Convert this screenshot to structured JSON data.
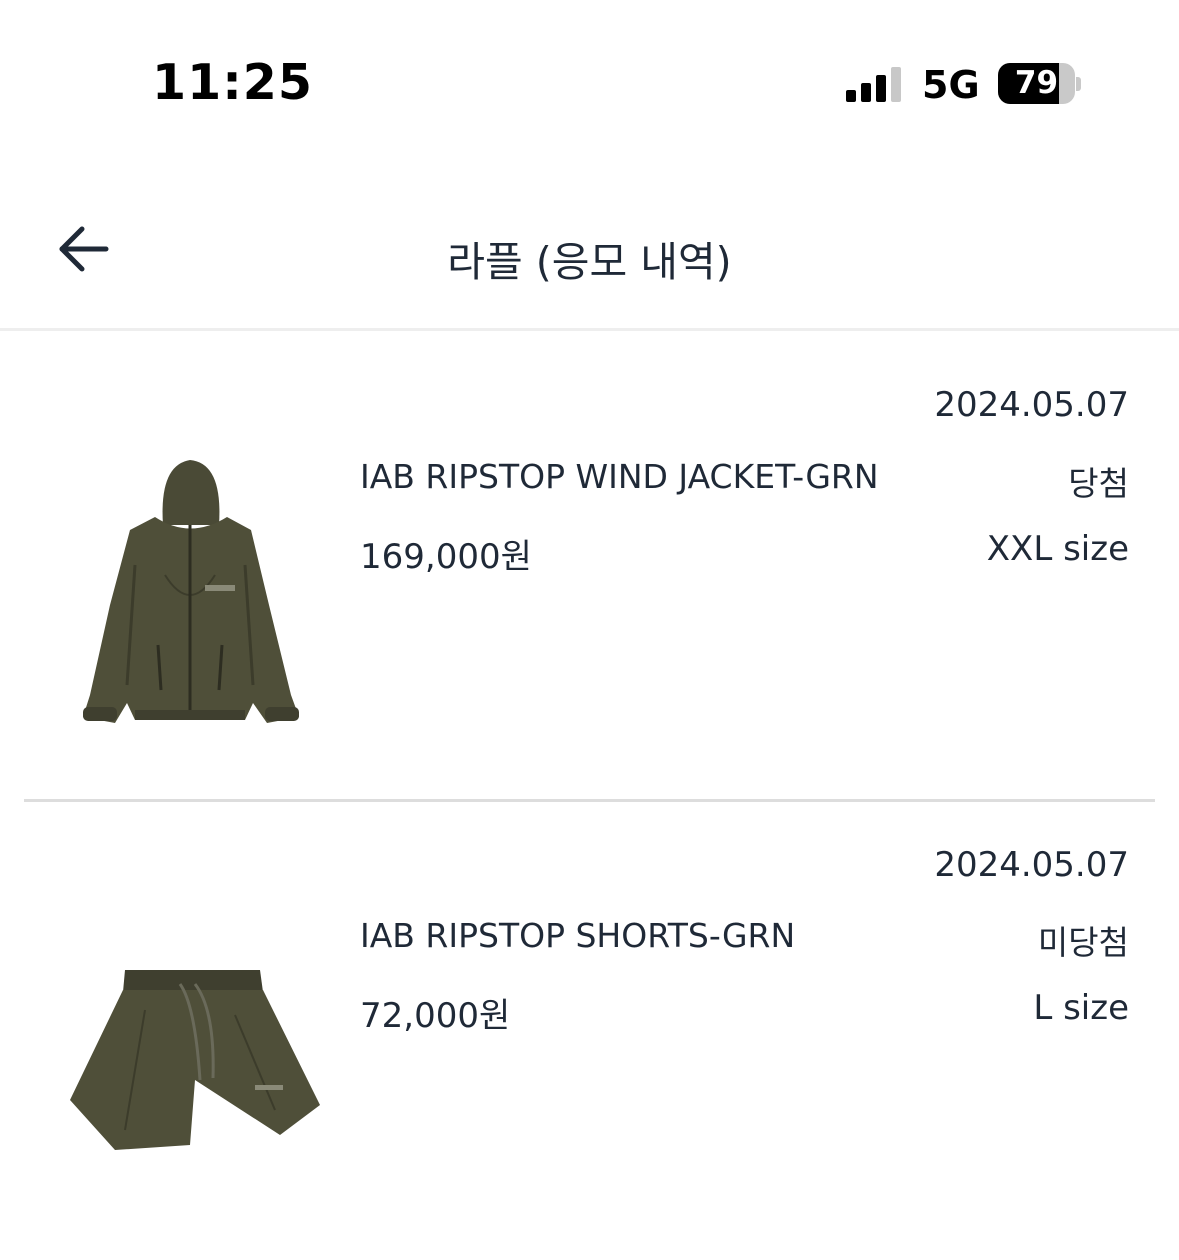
{
  "status_bar": {
    "time": "11:25",
    "network": "5G",
    "battery_level": "79",
    "signal_bars_active": 3,
    "icons": [
      "signal-icon",
      "battery-icon"
    ]
  },
  "header": {
    "title": "라플 (응모 내역)",
    "back_icon": "arrow-left-icon"
  },
  "orders": [
    {
      "date": "2024.05.07",
      "name": "IAB RIPSTOP WIND JACKET-GRN",
      "status": "당첨",
      "price": "169,000원",
      "size": "XXL size",
      "image_icon": "jacket-image"
    },
    {
      "date": "2024.05.07",
      "name": "IAB RIPSTOP SHORTS-GRN",
      "status": "미당첨",
      "price": "72,000원",
      "size": "L size",
      "image_icon": "shorts-image"
    }
  ],
  "colors": {
    "text": "#1f2937",
    "divider": "#dddddd",
    "product_olive": "#4a4a36"
  }
}
